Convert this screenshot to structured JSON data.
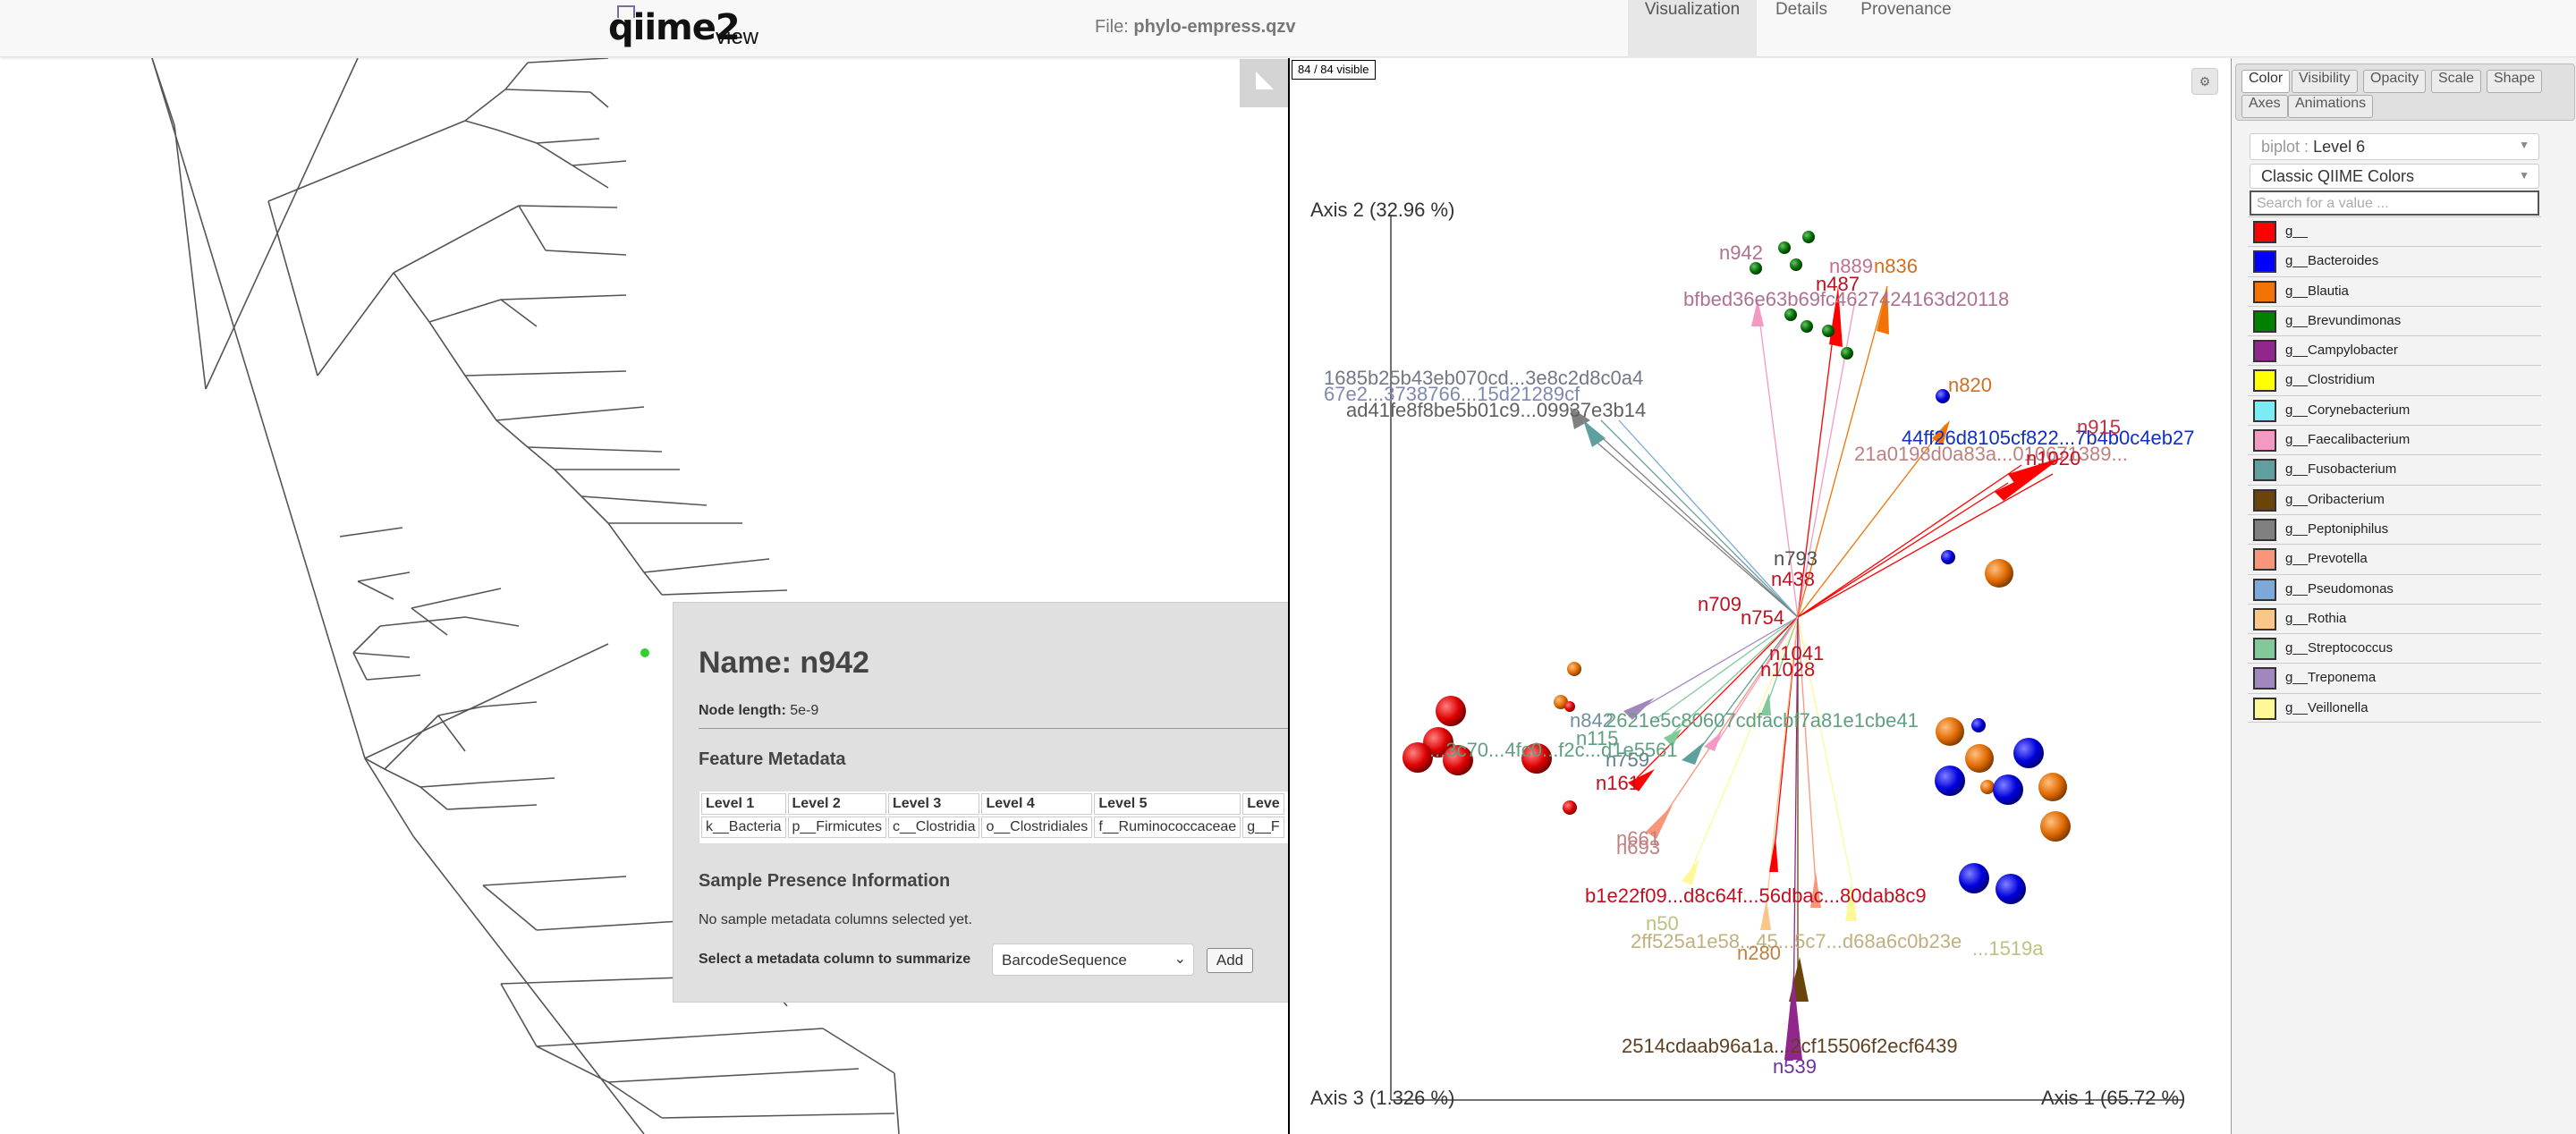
{
  "topbar": {
    "logo_main": "qiime",
    "logo_2": "2",
    "logo_view": "view",
    "file_prefix": "File:",
    "file_name": "phylo-empress.qzv",
    "tabs": [
      "Visualization",
      "Details",
      "Provenance"
    ],
    "active_tab": "Visualization"
  },
  "node_panel": {
    "name_prefix": "Name:",
    "name": "n942",
    "length_label": "Node length:",
    "length_value": "5e-9",
    "feature_metadata_title": "Feature Metadata",
    "table_headers": [
      "Level 1",
      "Level 2",
      "Level 3",
      "Level 4",
      "Level 5",
      "Leve"
    ],
    "table_row": [
      "k__Bacteria",
      "p__Firmicutes",
      "c__Clostridia",
      "o__Clostridiales",
      "f__Ruminococcaceae",
      "g__F"
    ],
    "sample_presence_title": "Sample Presence Information",
    "no_columns_text": "No sample metadata columns selected yet.",
    "select_label": "Select a metadata column to summarize",
    "select_value": "BarcodeSequence",
    "add_button": "Add"
  },
  "plot": {
    "visible_count": "84 / 84 visible",
    "axis1_label": "Axis 1 (65.72 %)",
    "axis2_label": "Axis 2 (32.96 %)",
    "axis3_label": "Axis 3 (1.326 %)",
    "arrow_labels": [
      {
        "text": "n942",
        "color": "#b07090"
      },
      {
        "text": "n889",
        "color": "#c07090"
      },
      {
        "text": "n836",
        "color": "#d07020"
      },
      {
        "text": "n487",
        "color": "#c01020"
      },
      {
        "text": "bfbed36e63b69fc4627424163d20118",
        "color": "#b07090"
      },
      {
        "text": "1685b25b43eb070cd...3e8c2d8c0a4",
        "color": "#707888"
      },
      {
        "text": "67e2...3738766...15d21289cf",
        "color": "#8088b0"
      },
      {
        "text": "ad41fe8f8be5b01c9...09937e3b14",
        "color": "#606060"
      },
      {
        "text": "n820",
        "color": "#d07020"
      },
      {
        "text": "44ff26d8105cf822...7b4b0c4eb27",
        "color": "#1030c0"
      },
      {
        "text": "21a0198d0a83a...010671389...",
        "color": "#c08080"
      },
      {
        "text": "n915",
        "color": "#c03040"
      },
      {
        "text": "n1020",
        "color": "#c01020"
      },
      {
        "text": "n793",
        "color": "#505050"
      },
      {
        "text": "n438",
        "color": "#c01020"
      },
      {
        "text": "n709",
        "color": "#c01020"
      },
      {
        "text": "n754",
        "color": "#c01020"
      },
      {
        "text": "n1041",
        "color": "#c01020"
      },
      {
        "text": "n1028",
        "color": "#c01020"
      },
      {
        "text": "n842",
        "color": "#7090a0"
      },
      {
        "text": "2621e5c80607cdfacbf7a81e1cbe41",
        "color": "#60a080"
      },
      {
        "text": "n115",
        "color": "#60a080"
      },
      {
        "text": "n759",
        "color": "#608090"
      },
      {
        "text": "...3c70...4fc0...f2c...d1e5561",
        "color": "#60a080"
      },
      {
        "text": "n161",
        "color": "#c01020"
      },
      {
        "text": "n661",
        "color": "#c08080"
      },
      {
        "text": "n693",
        "color": "#c08080"
      },
      {
        "text": "b1e22f09...d8c64f...56dbac...80dab8c9",
        "color": "#c01020"
      },
      {
        "text": "n50",
        "color": "#c0c080"
      },
      {
        "text": "2ff525a1e58...45...5c7...d68a6c0b23e",
        "color": "#c0b080"
      },
      {
        "text": "...1519a",
        "color": "#c0c080"
      },
      {
        "text": "n280",
        "color": "#c08040"
      },
      {
        "text": "2514cdaab96a1a...2cf15506f2ecf6439",
        "color": "#604020"
      },
      {
        "text": "n539",
        "color": "#7030a0"
      }
    ]
  },
  "menu": {
    "tabs_row1": [
      "Color",
      "Visibility",
      "Opacity",
      "Scale",
      "Shape"
    ],
    "tabs_row2": [
      "Axes",
      "Animations"
    ],
    "active_tab": "Color",
    "biplot_prefix": "biplot :",
    "biplot_value": "Level 6",
    "colormap_value": "Classic QIIME Colors",
    "search_placeholder": "Search for a value ...",
    "legend": [
      {
        "label": "g__",
        "color": "#ff0000"
      },
      {
        "label": "g__Bacteroides",
        "color": "#0000ff"
      },
      {
        "label": "g__Blautia",
        "color": "#f27304"
      },
      {
        "label": "g__Brevundimonas",
        "color": "#008000"
      },
      {
        "label": "g__Campylobacter",
        "color": "#91278d"
      },
      {
        "label": "g__Clostridium",
        "color": "#ffff00"
      },
      {
        "label": "g__Corynebacterium",
        "color": "#7cecf4"
      },
      {
        "label": "g__Faecalibacterium",
        "color": "#f49ac2"
      },
      {
        "label": "g__Fusobacterium",
        "color": "#5da09e"
      },
      {
        "label": "g__Oribacterium",
        "color": "#6b440b"
      },
      {
        "label": "g__Peptoniphilus",
        "color": "#808080"
      },
      {
        "label": "g__Prevotella",
        "color": "#f79679"
      },
      {
        "label": "g__Pseudomonas",
        "color": "#7da9d8"
      },
      {
        "label": "g__Rothia",
        "color": "#fcc688"
      },
      {
        "label": "g__Streptococcus",
        "color": "#80c99b"
      },
      {
        "label": "g__Treponema",
        "color": "#a287bf"
      },
      {
        "label": "g__Veillonella",
        "color": "#fff899"
      }
    ]
  }
}
